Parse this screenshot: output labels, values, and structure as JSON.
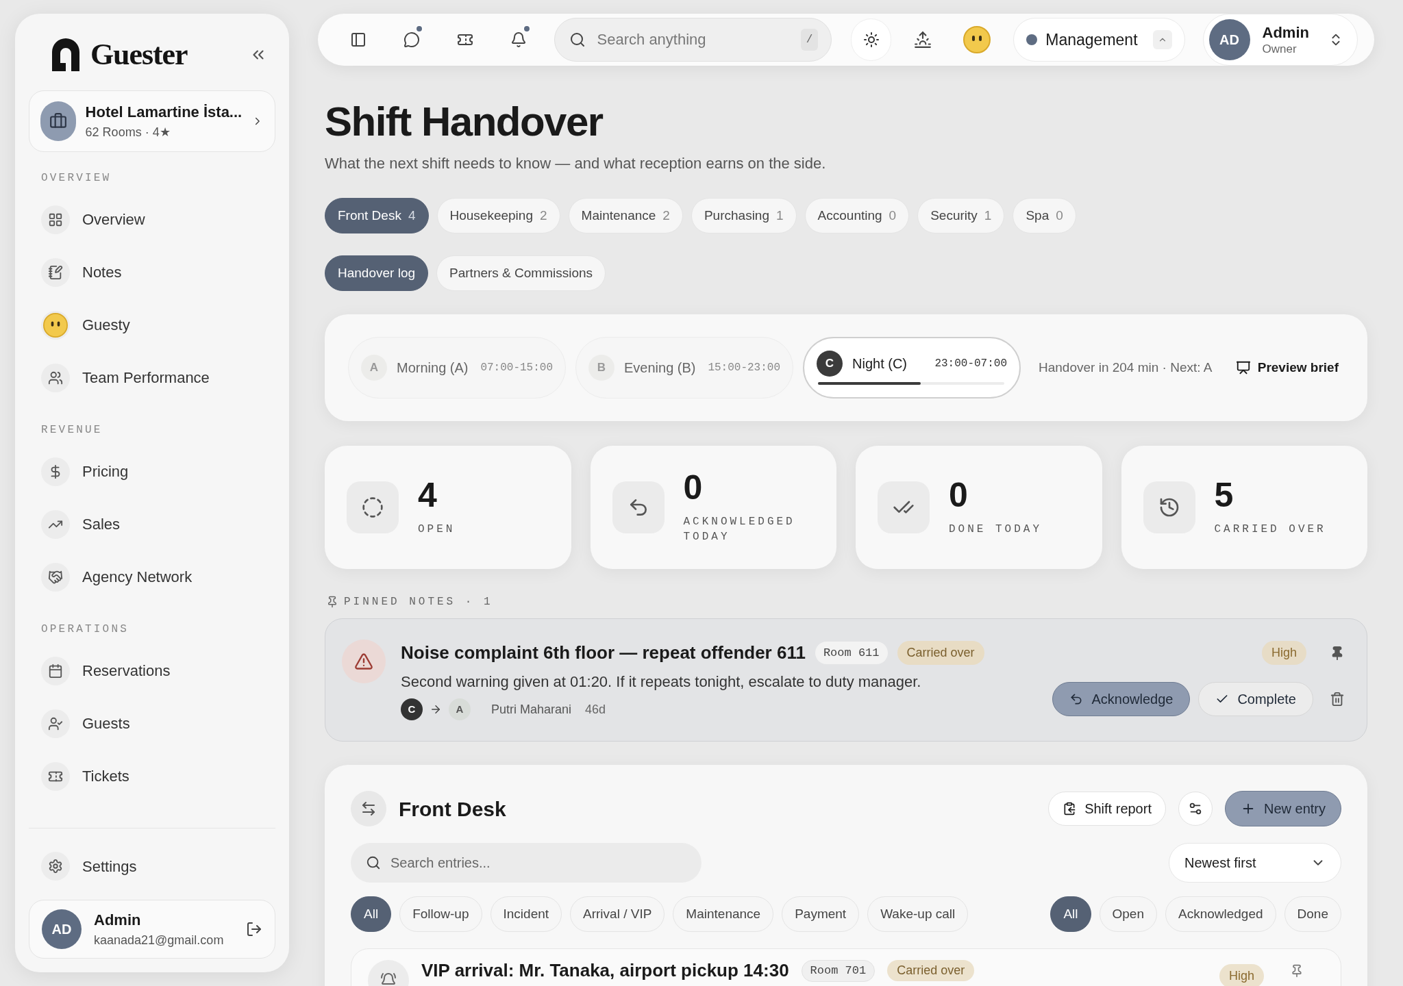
{
  "sidebar": {
    "brand": "Guester",
    "hotel": {
      "name": "Hotel Lamartine İsta...",
      "meta": "62 Rooms · 4★"
    },
    "sections": [
      {
        "title": "OVERVIEW",
        "items": [
          {
            "label": "Overview"
          },
          {
            "label": "Notes"
          },
          {
            "label": "Guesty"
          },
          {
            "label": "Team Performance"
          }
        ]
      },
      {
        "title": "REVENUE",
        "items": [
          {
            "label": "Pricing"
          },
          {
            "label": "Sales"
          },
          {
            "label": "Agency Network"
          }
        ]
      },
      {
        "title": "OPERATIONS",
        "items": [
          {
            "label": "Reservations"
          },
          {
            "label": "Guests"
          },
          {
            "label": "Tickets"
          }
        ]
      }
    ],
    "settings": "Settings",
    "user": {
      "initials": "AD",
      "name": "Admin",
      "email": "kaanada21@gmail.com"
    }
  },
  "topbar": {
    "icons": [
      {
        "unread": false
      },
      {
        "unread": true
      },
      {
        "unread": false
      },
      {
        "unread": true
      }
    ],
    "search": {
      "placeholder": "Search anything",
      "shortcut": "/"
    },
    "workspace": "Management",
    "user": {
      "initials": "AD",
      "name": "Admin",
      "role": "Owner"
    }
  },
  "page": {
    "title": "Shift Handover",
    "subtitle": "What the next shift needs to know — and what reception earns on the side."
  },
  "departments": [
    {
      "label": "Front Desk",
      "count": "4",
      "selected": true
    },
    {
      "label": "Housekeeping",
      "count": "2",
      "selected": false
    },
    {
      "label": "Maintenance",
      "count": "2",
      "selected": false
    },
    {
      "label": "Purchasing",
      "count": "1",
      "selected": false
    },
    {
      "label": "Accounting",
      "count": "0",
      "selected": false
    },
    {
      "label": "Security",
      "count": "1",
      "selected": false
    },
    {
      "label": "Spa",
      "count": "0",
      "selected": false
    }
  ],
  "views": [
    {
      "label": "Handover log",
      "selected": true
    },
    {
      "label": "Partners & Commissions",
      "selected": false
    }
  ],
  "shifts": [
    {
      "letter": "A",
      "name": "Morning (A)",
      "hours": "07:00-15:00",
      "selected": false
    },
    {
      "letter": "B",
      "name": "Evening (B)",
      "hours": "15:00-23:00",
      "selected": false
    },
    {
      "letter": "C",
      "name": "Night (C)",
      "hours": "23:00-07:00",
      "selected": true,
      "level": 0.55
    }
  ],
  "handover_info": "Handover in 204 min · Next: A",
  "preview_button": "Preview brief",
  "stats": [
    {
      "kind": "open",
      "value": "4",
      "label": "OPEN"
    },
    {
      "kind": "acknowledged",
      "value": "0",
      "label": "ACKNOWLEDGED TODAY"
    },
    {
      "kind": "done",
      "value": "0",
      "label": "DONE TODAY"
    },
    {
      "kind": "carried",
      "value": "5",
      "label": "CARRIED OVER"
    }
  ],
  "pinned": {
    "heading": "PINNED NOTES · 1",
    "notes": [
      {
        "title": "Noise complaint 6th floor — repeat offender 611",
        "room": "Room 611",
        "status": "Carried over",
        "body": "Second warning given at 01:20. If it repeats tonight, escalate to duty manager.",
        "from": "C",
        "to": "A",
        "author": "Putri Maharani",
        "age": "46d",
        "priority": "High",
        "pinned": true,
        "actions": [
          "Acknowledge",
          "Complete"
        ]
      }
    ]
  },
  "log": {
    "title": "Front Desk",
    "shift_report": "Shift report",
    "new_entry": "New entry",
    "search": {
      "placeholder": "Search entries..."
    },
    "sort": "Newest first",
    "categories": [
      {
        "label": "All",
        "selected": true
      },
      {
        "label": "Follow-up",
        "selected": false
      },
      {
        "label": "Incident",
        "selected": false
      },
      {
        "label": "Arrival / VIP",
        "selected": false
      },
      {
        "label": "Maintenance",
        "selected": false
      },
      {
        "label": "Payment",
        "selected": false
      },
      {
        "label": "Wake-up call",
        "selected": false
      }
    ],
    "statuses": [
      {
        "label": "All",
        "selected": true
      },
      {
        "label": "Open",
        "selected": false
      },
      {
        "label": "Acknowledged",
        "selected": false
      },
      {
        "label": "Done",
        "selected": false
      }
    ],
    "entries": [
      {
        "title": "VIP arrival: Mr. Tanaka, airport pickup 14:30",
        "room": "Room 701",
        "status": "Carried over",
        "priority": "High"
      }
    ]
  }
}
